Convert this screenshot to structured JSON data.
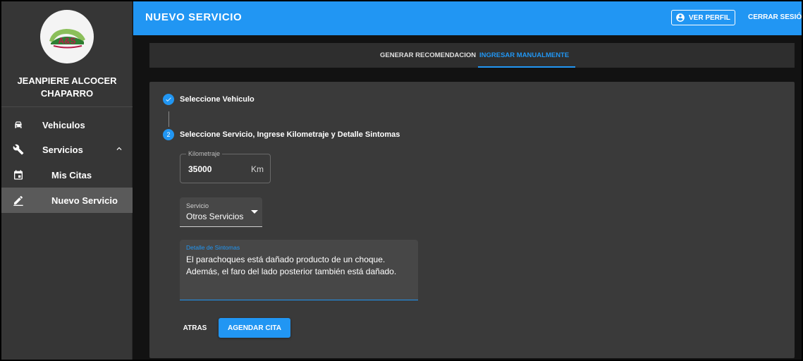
{
  "sidebar": {
    "logo_text": "A&S",
    "user_name": "JEANPIERE ALCOCER CHAPARRO",
    "items": [
      {
        "label": "Vehiculos",
        "icon": "car-icon"
      },
      {
        "label": "Servicios",
        "icon": "wrench-icon"
      },
      {
        "label": "Mis Citas",
        "icon": "calendar-icon"
      },
      {
        "label": "Nuevo Servicio",
        "icon": "pencil-icon"
      }
    ]
  },
  "header": {
    "title": "NUEVO SERVICIO",
    "profile_label": "VER PERFIL",
    "logout_label": "CERRAR SESIÓN"
  },
  "tabs": [
    {
      "label": "GENERAR RECOMENDACION",
      "active": false
    },
    {
      "label": "INGRESAR MANUALMENTE",
      "active": true
    }
  ],
  "stepper": {
    "step1_label": "Seleccione Vehiculo",
    "step2_number": "2",
    "step2_label": "Seleccione Servicio, Ingrese Kilometraje y Detalle Sintomas"
  },
  "form": {
    "km_label": "Kilometraje",
    "km_value": "35000",
    "km_suffix": "Km",
    "service_label": "Servicio",
    "service_value": "Otros Servicios",
    "details_label": "Detalle de Sintomas",
    "details_value": "El parachoques está dañado producto de un choque. Además, el faro del lado posterior también está dañado."
  },
  "actions": {
    "back_label": "ATRAS",
    "submit_label": "AGENDAR CITA"
  },
  "colors": {
    "accent": "#2196f3",
    "sidebar_bg": "#363636",
    "card_bg": "#3a3a3a"
  }
}
